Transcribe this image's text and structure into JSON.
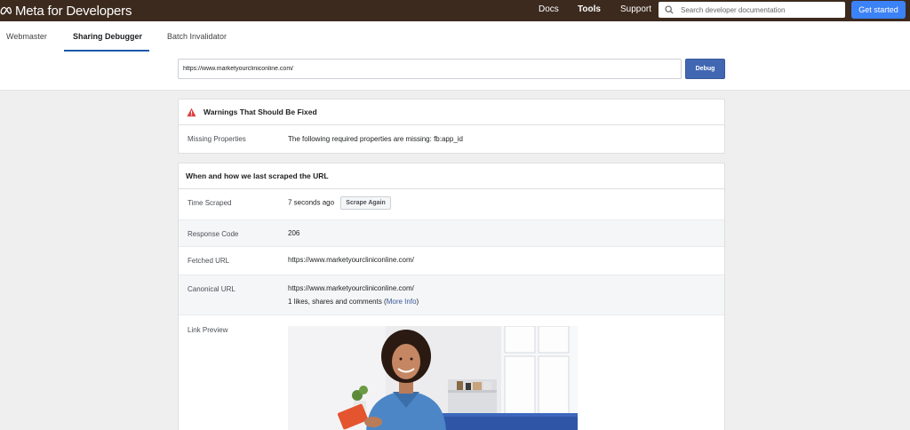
{
  "nav": {
    "brand": "Meta for Developers",
    "links": [
      "Docs",
      "Tools",
      "Support"
    ],
    "search_placeholder": "Search developer documentation",
    "cta": "Get started"
  },
  "tabs": [
    "Webmaster",
    "Sharing Debugger",
    "Batch Invalidator"
  ],
  "debugger": {
    "url_value": "https://www.marketyourcliniconline.com/",
    "debug_label": "Debug"
  },
  "warnings": {
    "title": "Warnings That Should Be Fixed",
    "label": "Missing Properties",
    "text": "The following required properties are missing: fb:app_id"
  },
  "scrape": {
    "title": "When and how we last scraped the URL",
    "time_label": "Time Scraped",
    "time_value": "7 seconds ago",
    "scrape_again": "Scrape Again",
    "response_label": "Response Code",
    "response_value": "206",
    "fetched_label": "Fetched URL",
    "fetched_value": "https://www.marketyourcliniconline.com/",
    "canonical_label": "Canonical URL",
    "canonical_value": "https://www.marketyourcliniconline.com/",
    "engagement_prefix": "1 likes, shares and comments (",
    "more_info": "More Info",
    "engagement_suffix": ")",
    "preview_label": "Link Preview"
  },
  "colors": {
    "nav_bg": "#3c2a1e",
    "cta": "#3b82f6",
    "debug": "#4267b2",
    "link": "#365899",
    "warning": "#e03e3e"
  }
}
